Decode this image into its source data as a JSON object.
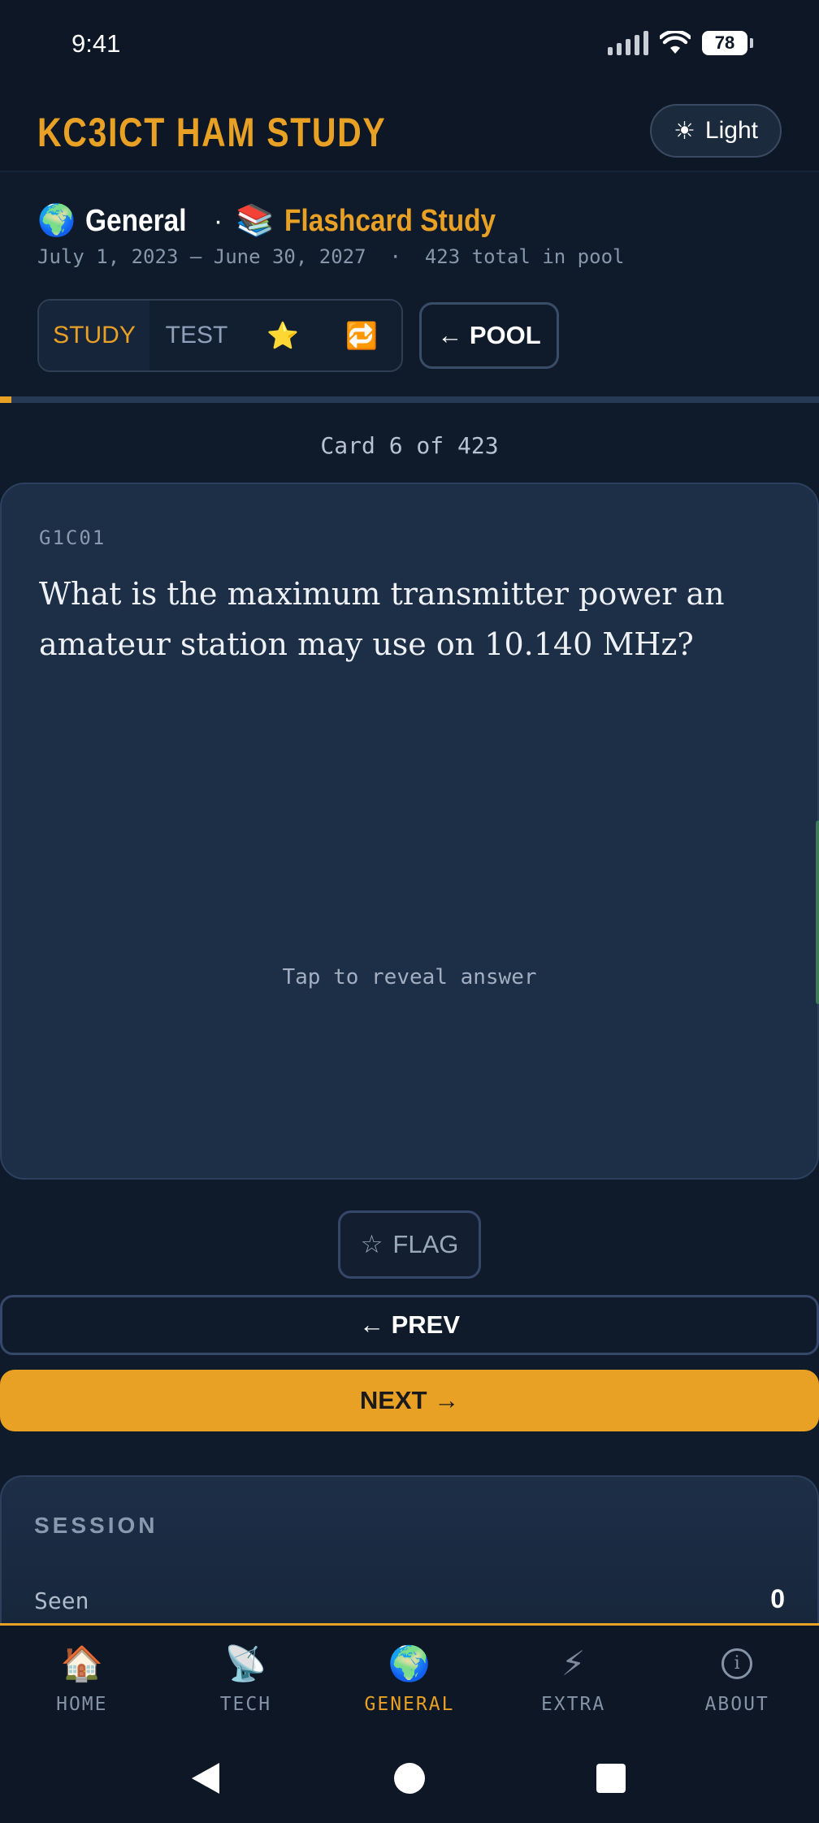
{
  "status_bar": {
    "time": "9:41",
    "battery": "78"
  },
  "header": {
    "title": "KC3ICT HAM STUDY",
    "theme_icon": "☀",
    "theme_label": "Light"
  },
  "section": {
    "icon": "🌍",
    "name": "General",
    "separator": "·",
    "mode_icon": "📚",
    "mode": "Flashcard Study",
    "meta": "July 1, 2023 – June 30, 2027  ·  423 total in pool"
  },
  "tabs": [
    {
      "label": "STUDY",
      "active": true
    },
    {
      "label": "TEST",
      "active": false
    },
    {
      "label": "⭐",
      "icon": "star-icon"
    },
    {
      "label": "🔁",
      "icon": "repeat-icon"
    }
  ],
  "pool_button": "← POOL",
  "progress": {
    "current": 6,
    "total": 423
  },
  "counter": "Card 6 of 423",
  "card": {
    "id": "G1C01",
    "question": "What is the maximum transmitter power an amateur station may use on 10.140 MHz?",
    "hint": "Tap to reveal answer"
  },
  "actions": {
    "flag": "FLAG",
    "flag_icon": "☆",
    "prev": "← PREV",
    "next": "NEXT →"
  },
  "session": {
    "title": "SESSION",
    "rows": [
      {
        "label": "Seen",
        "value": "0"
      }
    ]
  },
  "nav": [
    {
      "label": "HOME",
      "icon": "🏠"
    },
    {
      "label": "TECH",
      "icon": "📡"
    },
    {
      "label": "GENERAL",
      "icon": "🌍",
      "active": true
    },
    {
      "label": "EXTRA",
      "icon": "⚡"
    },
    {
      "label": "ABOUT",
      "icon": "i"
    }
  ],
  "colors": {
    "accent": "#e8a124",
    "background": "#0f1b2b",
    "card": "#1d2e47"
  }
}
